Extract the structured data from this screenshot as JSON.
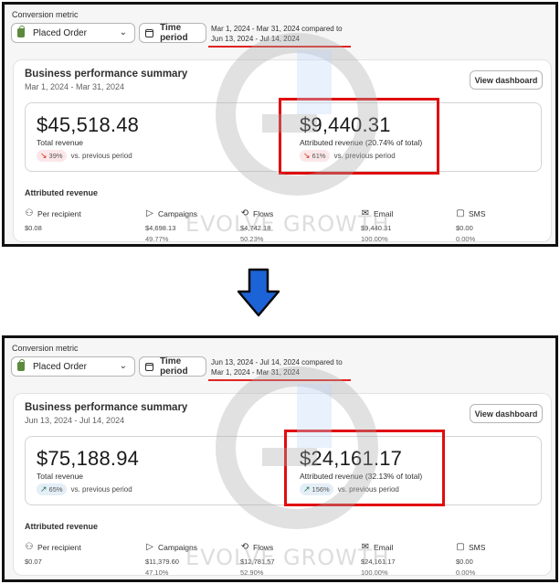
{
  "colors": {
    "accent_red": "#e00d0d",
    "arrow_blue": "#1d63d8",
    "up_green": "#1a7a50",
    "down_red": "#d72c0d"
  },
  "watermark": {
    "text": "EVOLVE GROWTH"
  },
  "before": {
    "conversion_metric_label": "Conversion metric",
    "metric_select": "Placed Order",
    "time_period_label": "Time period",
    "date_range_text": "Mar 1, 2024 - Mar 31, 2024 compared to Jun 13, 2024 - Jul 14, 2024",
    "summary_title": "Business performance summary",
    "summary_date": "Mar 1, 2024 - Mar 31, 2024",
    "view_dashboard": "View dashboard",
    "total_revenue": {
      "value": "$45,518.48",
      "label": "Total revenue",
      "change": "39%",
      "change_dir": "down",
      "suffix": "vs. previous period"
    },
    "attributed_revenue": {
      "value": "$9,440.31",
      "label": "Attributed revenue (20.74% of total)",
      "change": "61%",
      "change_dir": "down",
      "suffix": "vs. previous period"
    },
    "attributed_title": "Attributed revenue",
    "columns": [
      {
        "label": "Per recipient",
        "icon": "people-icon",
        "value": "$0.08",
        "pct": ""
      },
      {
        "label": "Campaigns",
        "icon": "send-icon",
        "value": "$4,698.13",
        "pct": "49.77%"
      },
      {
        "label": "Flows",
        "icon": "flow-icon",
        "value": "$4,742.18",
        "pct": "50.23%"
      },
      {
        "label": "Email",
        "icon": "email-icon",
        "value": "$9,440.31",
        "pct": "100.00%"
      },
      {
        "label": "SMS",
        "icon": "sms-icon",
        "value": "$0.00",
        "pct": "0.00%"
      }
    ]
  },
  "after": {
    "conversion_metric_label": "Conversion metric",
    "metric_select": "Placed Order",
    "time_period_label": "Time period",
    "date_range_text": "Jun 13, 2024 - Jul 14, 2024 compared to Mar 1, 2024 - Mar 31, 2024",
    "summary_title": "Business performance summary",
    "summary_date": "Jun 13, 2024 - Jul 14, 2024",
    "view_dashboard": "View dashboard",
    "total_revenue": {
      "value": "$75,188.94",
      "label": "Total revenue",
      "change": "65%",
      "change_dir": "up",
      "suffix": "vs. previous period"
    },
    "attributed_revenue": {
      "value": "$24,161.17",
      "label": "Attributed revenue (32.13% of total)",
      "change": "156%",
      "change_dir": "up",
      "suffix": "vs. previous period"
    },
    "attributed_title": "Attributed revenue",
    "columns": [
      {
        "label": "Per recipient",
        "icon": "people-icon",
        "value": "$0.07",
        "pct": ""
      },
      {
        "label": "Campaigns",
        "icon": "send-icon",
        "value": "$11,379.60",
        "pct": "47.10%"
      },
      {
        "label": "Flows",
        "icon": "flow-icon",
        "value": "$12,781.57",
        "pct": "52.90%"
      },
      {
        "label": "Email",
        "icon": "email-icon",
        "value": "$24,161.17",
        "pct": "100.00%"
      },
      {
        "label": "SMS",
        "icon": "sms-icon",
        "value": "$0.00",
        "pct": "0.00%"
      }
    ]
  }
}
